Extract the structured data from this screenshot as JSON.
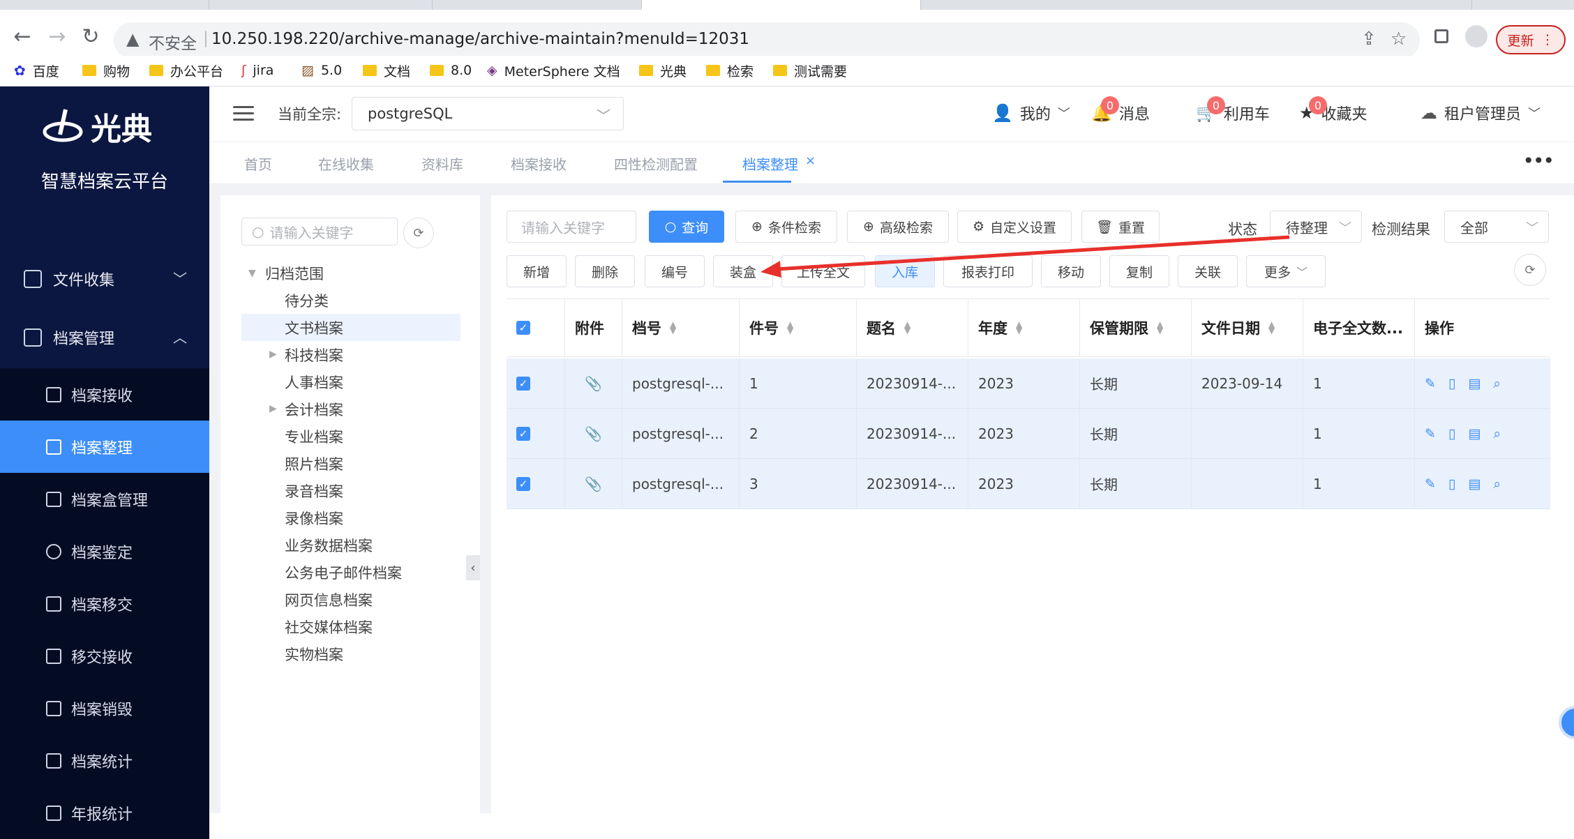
{
  "browser": {
    "security_label": "不安全",
    "url": "10.250.198.220/archive-manage/archive-maintain?menuId=12031",
    "update_label": "更新"
  },
  "bookmarks": [
    "百度",
    "购物",
    "办公平台",
    "jira",
    "5.0",
    "文档",
    "8.0",
    "MeterSphere 文档",
    "光典",
    "检索",
    "测试需要"
  ],
  "app": {
    "logo_text": "光典",
    "platform_name": "智慧档案云平台"
  },
  "sidebar": {
    "menus": [
      {
        "label": "文件收集"
      },
      {
        "label": "档案管理"
      }
    ],
    "sub_items": [
      {
        "label": "档案接收"
      },
      {
        "label": "档案整理"
      },
      {
        "label": "档案盒管理"
      },
      {
        "label": "档案鉴定"
      },
      {
        "label": "档案移交"
      },
      {
        "label": "移交接收"
      },
      {
        "label": "档案销毁"
      },
      {
        "label": "档案统计"
      },
      {
        "label": "年报统计"
      }
    ]
  },
  "header": {
    "current_label": "当前全宗:",
    "current_value": "postgreSQL",
    "mine": "我的",
    "messages": "消息",
    "messages_count": "0",
    "cart": "利用车",
    "cart_count": "0",
    "favorites": "收藏夹",
    "favorites_count": "0",
    "user": "租户管理员"
  },
  "tabs": [
    "首页",
    "在线收集",
    "资料库",
    "档案接收",
    "四性检测配置",
    "档案整理"
  ],
  "tree": {
    "search_placeholder": "请输入关键字",
    "root": "归档范围",
    "nodes": [
      "待分类",
      "文书档案",
      "科技档案",
      "人事档案",
      "会计档案",
      "专业档案",
      "照片档案",
      "录音档案",
      "录像档案",
      "业务数据档案",
      "公务电子邮件档案",
      "网页信息档案",
      "社交媒体档案",
      "实物档案"
    ]
  },
  "toolbar": {
    "keyword_placeholder": "请输入关键字",
    "query": "查询",
    "condition_search": "条件检索",
    "advanced_search": "高级检索",
    "custom_settings": "自定义设置",
    "reset": "重置",
    "status_label": "状态",
    "status_value": "待整理",
    "check_label": "检测结果",
    "check_value": "全部",
    "actions": [
      "新增",
      "删除",
      "编号",
      "装盒",
      "上传全文",
      "入库",
      "报表打印",
      "移动",
      "复制",
      "关联",
      "更多"
    ]
  },
  "table": {
    "headers": [
      "附件",
      "档号",
      "件号",
      "题名",
      "年度",
      "保管期限",
      "文件日期",
      "电子全文数...",
      "操作"
    ],
    "rows": [
      {
        "code": "postgresql-...",
        "num": "1",
        "title": "20230914-...",
        "year": "2023",
        "period": "长期",
        "date": "2023-09-14",
        "count": "1"
      },
      {
        "code": "postgresql-...",
        "num": "2",
        "title": "20230914-...",
        "year": "2023",
        "period": "长期",
        "date": "",
        "count": "1"
      },
      {
        "code": "postgresql-...",
        "num": "3",
        "title": "20230914-...",
        "year": "2023",
        "period": "长期",
        "date": "",
        "count": "1"
      }
    ]
  },
  "colors": {
    "sidebar_bg": "#0b1740",
    "accent": "#3d8ef8",
    "annotation_arrow": "#e8302a"
  }
}
